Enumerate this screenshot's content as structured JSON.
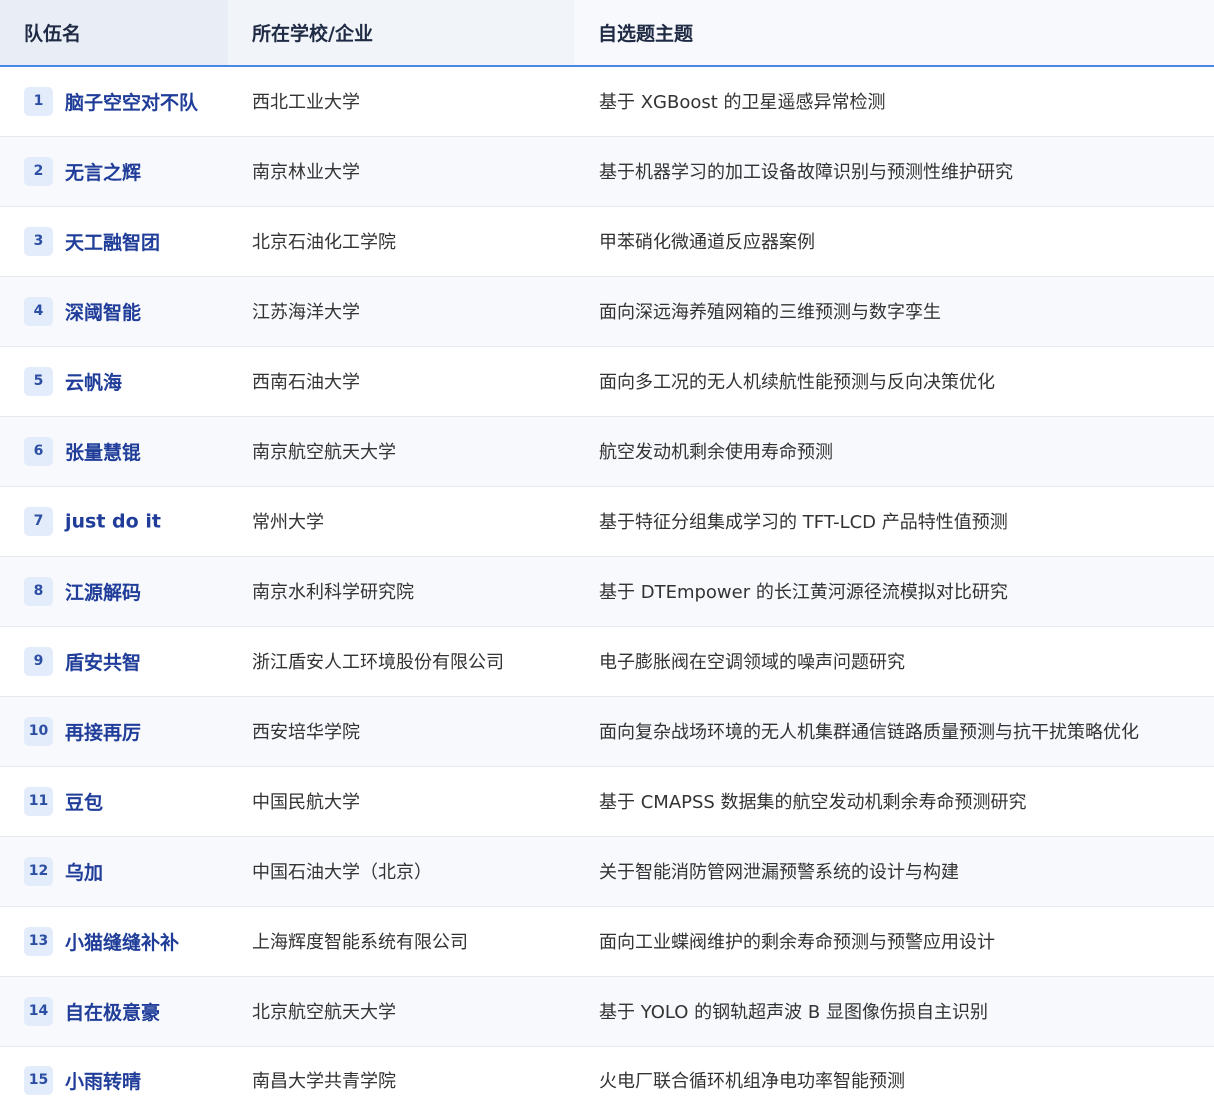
{
  "header": {
    "team": "队伍名",
    "school": "所在学校/企业",
    "topic": "自选题主题"
  },
  "rows": [
    {
      "num": "1",
      "team": "脑子空空对不队",
      "school": "西北工业大学",
      "topic": "基于 XGBoost 的卫星遥感异常检测"
    },
    {
      "num": "2",
      "team": "无言之辉",
      "school": "南京林业大学",
      "topic": "基于机器学习的加工设备故障识别与预测性维护研究"
    },
    {
      "num": "3",
      "team": "天工融智团",
      "school": "北京石油化工学院",
      "topic": "甲苯硝化微通道反应器案例"
    },
    {
      "num": "4",
      "team": "深阈智能",
      "school": "江苏海洋大学",
      "topic": "面向深远海养殖网箱的三维预测与数字孪生"
    },
    {
      "num": "5",
      "team": "云帆海",
      "school": "西南石油大学",
      "topic": "面向多工况的无人机续航性能预测与反向决策优化"
    },
    {
      "num": "6",
      "team": "张量慧锟",
      "school": "南京航空航天大学",
      "topic": "航空发动机剩余使用寿命预测"
    },
    {
      "num": "7",
      "team": "just do it",
      "school": "常州大学",
      "topic": "基于特征分组集成学习的 TFT-LCD 产品特性值预测"
    },
    {
      "num": "8",
      "team": "江源解码",
      "school": "南京水利科学研究院",
      "topic": "基于 DTEmpower 的长江黄河源径流模拟对比研究"
    },
    {
      "num": "9",
      "team": "盾安共智",
      "school": "浙江盾安人工环境股份有限公司",
      "topic": "电子膨胀阀在空调领域的噪声问题研究"
    },
    {
      "num": "10",
      "team": "再接再厉",
      "school": "西安培华学院",
      "topic": "面向复杂战场环境的无人机集群通信链路质量预测与抗干扰策略优化"
    },
    {
      "num": "11",
      "team": "豆包",
      "school": "中国民航大学",
      "topic": "基于 CMAPSS 数据集的航空发动机剩余寿命预测研究"
    },
    {
      "num": "12",
      "team": "乌加",
      "school": "中国石油大学（北京）",
      "topic": "关于智能消防管网泄漏预警系统的设计与构建"
    },
    {
      "num": "13",
      "team": "小猫缝缝补补",
      "school": "上海辉度智能系统有限公司",
      "topic": "面向工业蝶阀维护的剩余寿命预测与预警应用设计"
    },
    {
      "num": "14",
      "team": "自在极意豪",
      "school": "北京航空航天大学",
      "topic": "基于 YOLO 的钢轨超声波 B 显图像伤损自主识别"
    },
    {
      "num": "15",
      "team": "小雨转晴",
      "school": "南昌大学共青学院",
      "topic": "火电厂联合循环机组净电功率智能预测"
    }
  ]
}
